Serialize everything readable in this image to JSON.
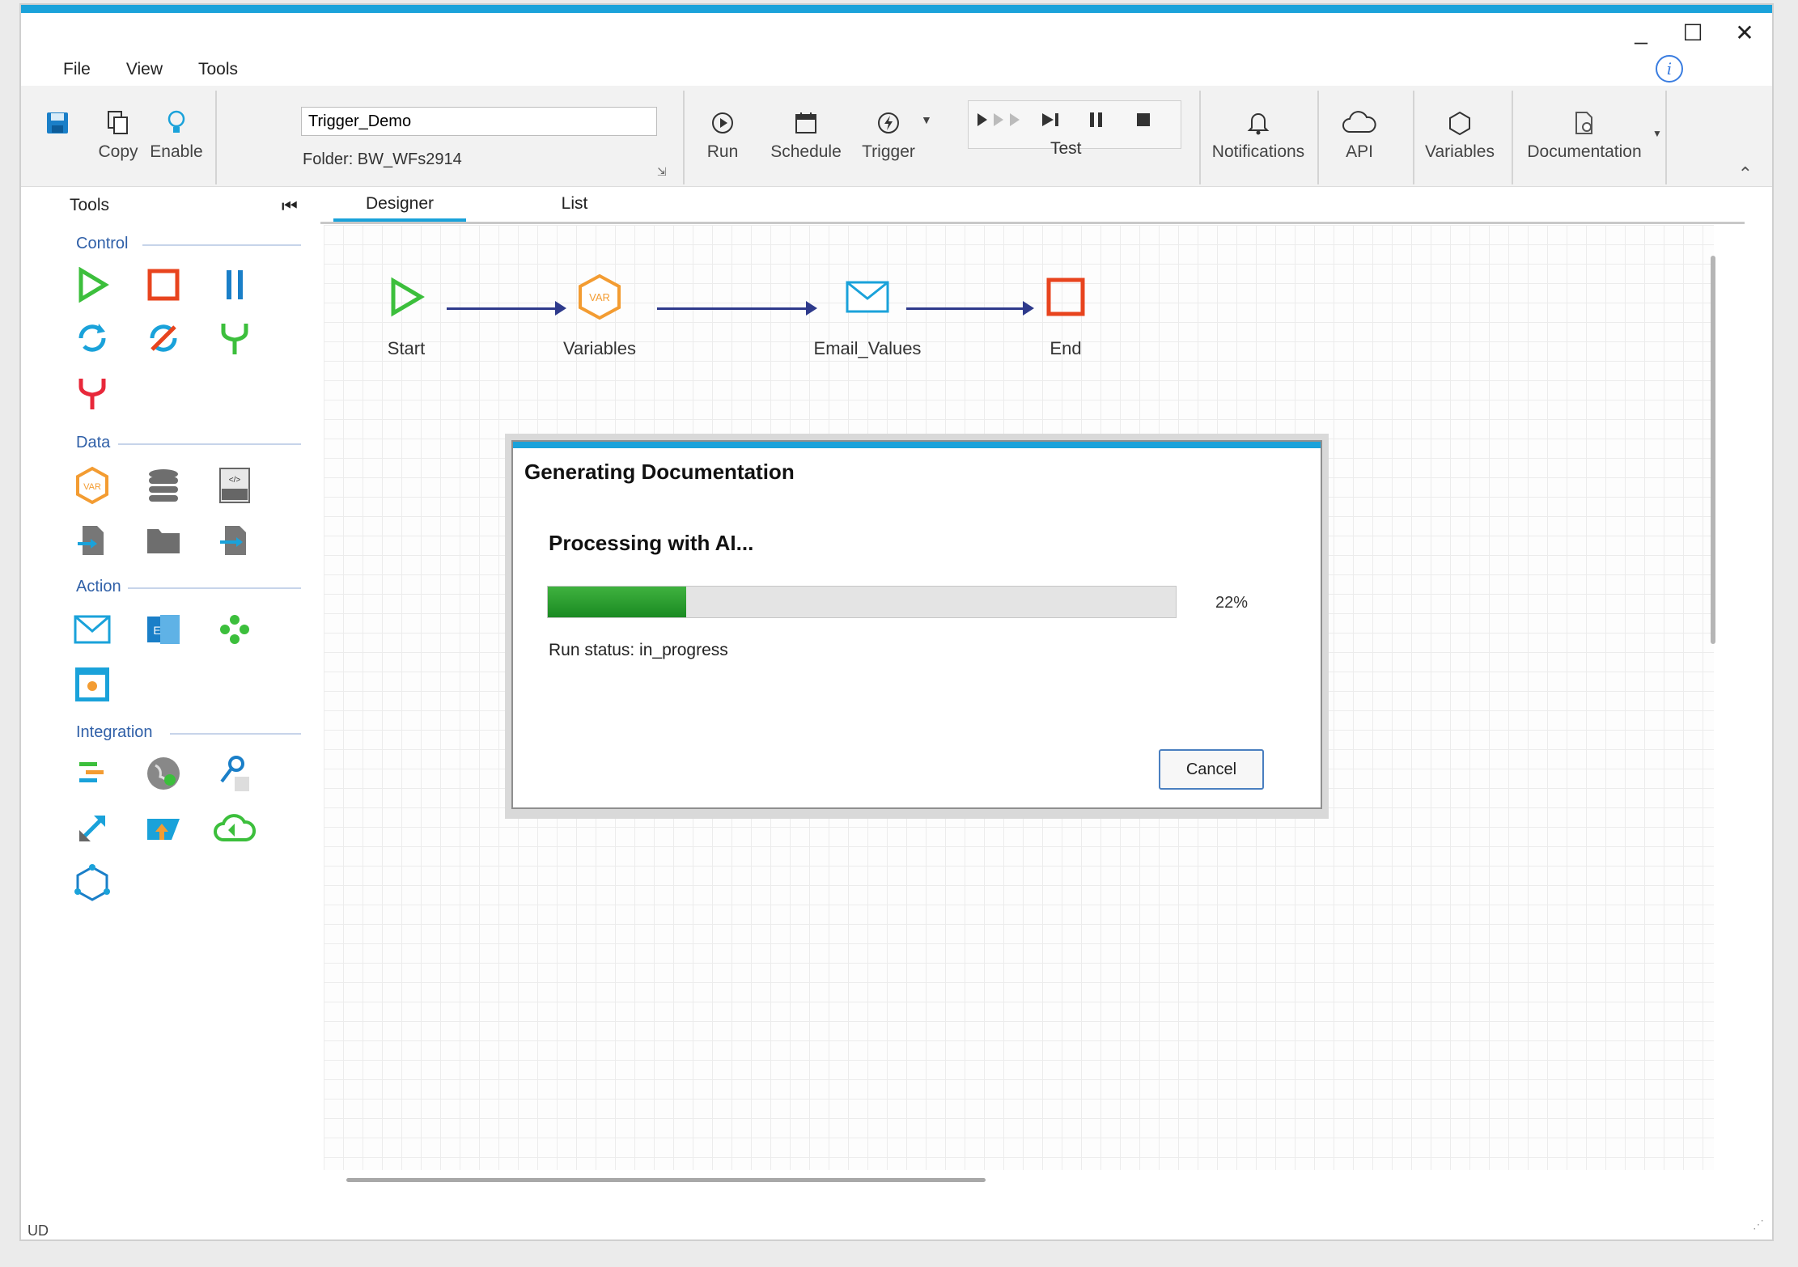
{
  "window": {
    "minimize": "_",
    "maximize": "☐",
    "close": "✕",
    "statusbar_text": "UD"
  },
  "menu": [
    "File",
    "View",
    "Tools"
  ],
  "ribbon": {
    "copy_label": "Copy",
    "enable_label": "Enable",
    "workflow_name": "Trigger_Demo",
    "folder_text": "Folder:  BW_WFs2914",
    "run_label": "Run",
    "schedule_label": "Schedule",
    "trigger_label": "Trigger",
    "test_label": "Test",
    "notifications_label": "Notifications",
    "api_label": "API",
    "variables_label": "Variables",
    "documentation_label": "Documentation"
  },
  "tools": {
    "title": "Tools",
    "sections": {
      "control": "Control",
      "data": "Data",
      "action": "Action",
      "integration": "Integration"
    }
  },
  "tabs": {
    "designer": "Designer",
    "list": "List"
  },
  "workflow": {
    "nodes": [
      "Start",
      "Variables",
      "Email_Values",
      "End"
    ],
    "var_badge": "VAR"
  },
  "dialog": {
    "title": "Generating Documentation",
    "message": "Processing with AI...",
    "progress": 0.22,
    "progress_text": "22%",
    "status": "Run status: in_progress",
    "cancel_label": "Cancel"
  },
  "colors": {
    "accent": "#1aa2da",
    "start_green": "#3cbf3c",
    "end_red": "#e8441e",
    "arrow": "#2e3a8c",
    "progress_green": "#1a8a22"
  }
}
